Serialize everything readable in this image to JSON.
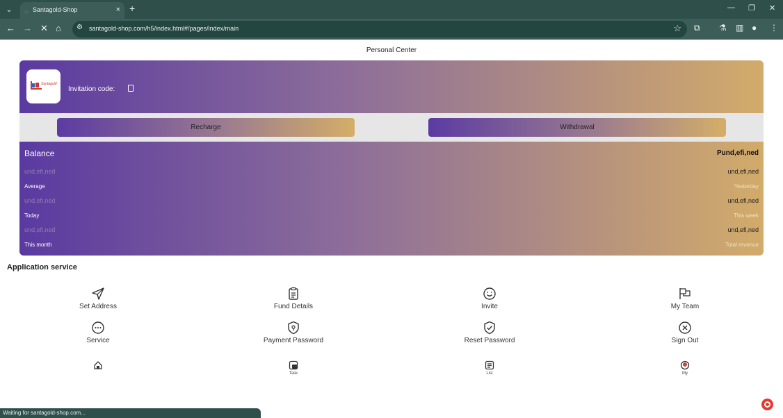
{
  "browser": {
    "tab_title": "Santagold-Shop",
    "url": "santagold-shop.com/h5/index.html#/pages/index/main",
    "status_text": "Waiting for santagold-shop.com..."
  },
  "page": {
    "title": "Personal Center"
  },
  "profile": {
    "invitation_label": "Invitation code:",
    "logo_text": "Santagold"
  },
  "actions": {
    "recharge": "Recharge",
    "withdrawal": "Withdrawal"
  },
  "stats": {
    "balance_label": "Balance",
    "balance_value": "Pund,efi,ned",
    "rows": [
      {
        "left_value": "und,efi,ned",
        "left_label": "Average",
        "right_value": "und,efi,ned",
        "right_label": "Yesterday"
      },
      {
        "left_value": "und,efi,ned",
        "left_label": "Today",
        "right_value": "und,efi,ned",
        "right_label": "This week"
      },
      {
        "left_value": "und,efi,ned",
        "left_label": "This month",
        "right_value": "und,efi,ned",
        "right_label": "Total revenue"
      }
    ]
  },
  "services": {
    "title": "Application service",
    "items": [
      {
        "label": "Set Address",
        "icon": "send-icon"
      },
      {
        "label": "Fund Details",
        "icon": "clipboard-icon"
      },
      {
        "label": "Invite",
        "icon": "smile-icon"
      },
      {
        "label": "My Team",
        "icon": "flags-icon"
      },
      {
        "label": "Service",
        "icon": "chat-icon"
      },
      {
        "label": "Payment Password",
        "icon": "shield-lock-icon"
      },
      {
        "label": "Reset Password",
        "icon": "shield-check-icon"
      },
      {
        "label": "Sign Out",
        "icon": "close-circle-icon"
      }
    ]
  },
  "tabbar": {
    "items": [
      {
        "label": "",
        "icon": "home-icon"
      },
      {
        "label": "Task",
        "icon": "task-icon"
      },
      {
        "label": "List",
        "icon": "list-icon"
      },
      {
        "label": "My",
        "icon": "user-icon"
      }
    ]
  },
  "colors": {
    "gradient_start": "#5a3aa0",
    "gradient_mid": "#8e6f99",
    "gradient_end": "#d2ab6a",
    "chrome_bg": "#3d5e58"
  }
}
